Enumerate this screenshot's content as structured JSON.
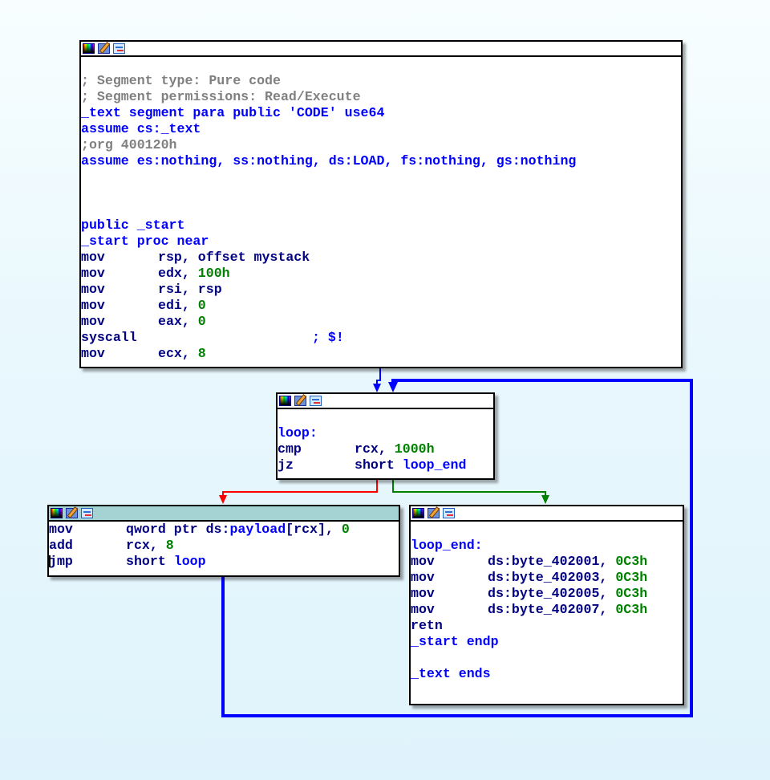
{
  "colors": {
    "background": "#e6f6fc",
    "comment": "#808080",
    "label": "#0000ff",
    "mnemonic": "#000080",
    "immediate": "#008000",
    "edge_true": "#008000",
    "edge_false": "#ff0000",
    "edge_unconditional": "#0000ff",
    "selected_titlebar": "#a5d3d3"
  },
  "titlebar_icons": [
    "color-palette-icon",
    "edit-pencil-icon",
    "graph-overview-icon"
  ],
  "nodes": {
    "entry": {
      "lines": [
        {
          "type": "blank"
        },
        {
          "type": "comment",
          "text": "; Segment type: Pure code"
        },
        {
          "type": "comment",
          "text": "; Segment permissions: Read/Execute"
        },
        {
          "type": "directive",
          "text": "_text segment para public 'CODE' use64"
        },
        {
          "type": "directive",
          "text": "assume cs:_text"
        },
        {
          "type": "comment",
          "text": ";org 400120h"
        },
        {
          "type": "directive",
          "text": "assume es:nothing, ss:nothing, ds:LOAD, fs:nothing, gs:nothing"
        },
        {
          "type": "blank"
        },
        {
          "type": "blank"
        },
        {
          "type": "blank"
        },
        {
          "type": "directive",
          "text": "public _start"
        },
        {
          "type": "directive",
          "text": "_start proc near"
        },
        {
          "type": "insn",
          "mnemonic": "mov",
          "operand": "rsp, offset mystack",
          "imm": ""
        },
        {
          "type": "insn",
          "mnemonic": "mov",
          "operand": "edx, ",
          "imm": "100h"
        },
        {
          "type": "insn",
          "mnemonic": "mov",
          "operand": "rsi, rsp",
          "imm": ""
        },
        {
          "type": "insn",
          "mnemonic": "mov",
          "operand": "edi, ",
          "imm": "0"
        },
        {
          "type": "insn",
          "mnemonic": "mov",
          "operand": "eax, ",
          "imm": "0"
        },
        {
          "type": "insn_comment",
          "mnemonic": "syscall",
          "comment": "; $!"
        },
        {
          "type": "insn",
          "mnemonic": "mov",
          "operand": "ecx, ",
          "imm": "8"
        }
      ]
    },
    "loop": {
      "label": "loop:",
      "cmp": {
        "mnemonic": "cmp",
        "operand": "rcx, ",
        "imm": "1000h"
      },
      "jz": {
        "mnemonic": "jz",
        "operand": "short ",
        "target": "loop_end"
      }
    },
    "body": {
      "mov": {
        "mnemonic": "mov",
        "operand": "qword ptr ds:",
        "sym": "payload",
        "rest": "[rcx], ",
        "imm": "0"
      },
      "add": {
        "mnemonic": "add",
        "operand": "rcx, ",
        "imm": "8"
      },
      "jmp": {
        "mnemonic": "jmp",
        "operand": "short ",
        "target": "loop"
      }
    },
    "end": {
      "label": "loop_end:",
      "movs": [
        {
          "mnemonic": "mov",
          "operand": "ds:byte_402001, ",
          "imm": "0C3h"
        },
        {
          "mnemonic": "mov",
          "operand": "ds:byte_402003, ",
          "imm": "0C3h"
        },
        {
          "mnemonic": "mov",
          "operand": "ds:byte_402005, ",
          "imm": "0C3h"
        },
        {
          "mnemonic": "mov",
          "operand": "ds:byte_402007, ",
          "imm": "0C3h"
        }
      ],
      "retn": "retn",
      "endp": "_start endp",
      "ends": "_text ends"
    }
  }
}
